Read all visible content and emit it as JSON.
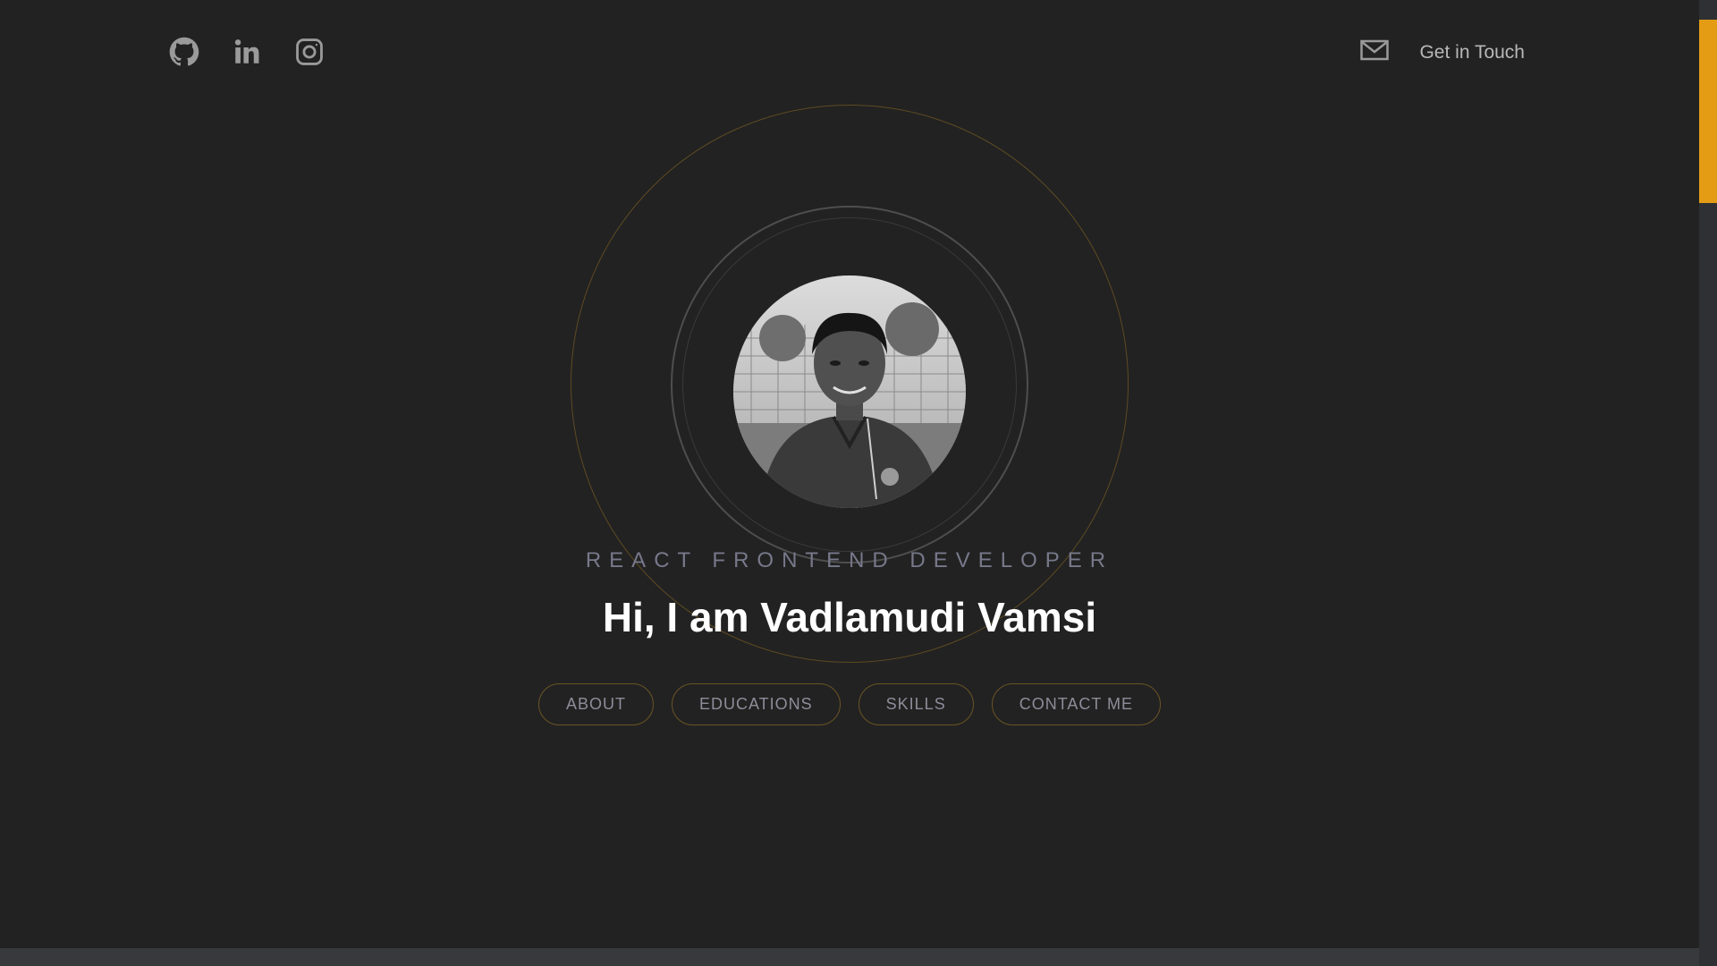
{
  "header": {
    "social": [
      {
        "icon": "github-icon"
      },
      {
        "icon": "linkedin-icon"
      },
      {
        "icon": "instagram-icon"
      }
    ],
    "contact_icon": "mail-icon",
    "contact_label": "Get in Touch"
  },
  "hero": {
    "role": "REACT FRONTEND DEVELOPER",
    "greeting": "Hi, I am Vadlamudi Vamsi",
    "nav": [
      "ABOUT",
      "EDUCATIONS",
      "SKILLS",
      "CONTACT ME"
    ]
  },
  "colors": {
    "background": "#222222",
    "accent": "#e39c14",
    "ring_outer": "#5e4a22",
    "muted_text": "#77788a"
  }
}
